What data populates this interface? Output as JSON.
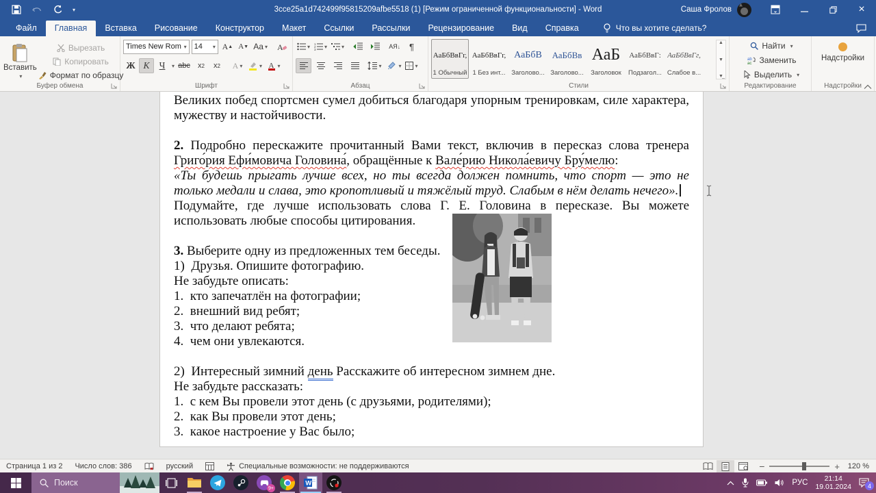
{
  "titlebar": {
    "title": "3cce25a1d742499f95815209afbe5518 (1) [Режим ограниченной функциональности]  -  Word",
    "user_name": "Саша Фролов"
  },
  "tabs": {
    "file": "Файл",
    "items": [
      "Главная",
      "Вставка",
      "Рисование",
      "Конструктор",
      "Макет",
      "Ссылки",
      "Рассылки",
      "Рецензирование",
      "Вид",
      "Справка"
    ],
    "active": "Главная",
    "tell_me": "Что вы хотите сделать?"
  },
  "ribbon": {
    "clipboard": {
      "label": "Буфер обмена",
      "paste": "Вставить",
      "cut": "Вырезать",
      "copy": "Копировать",
      "format_painter": "Формат по образцу"
    },
    "font": {
      "label": "Шрифт",
      "family": "Times New Rom",
      "size": "14",
      "bold": "Ж",
      "italic": "К",
      "underline": "Ч",
      "strike": "abc",
      "case_btn": "Aa",
      "effects": "А",
      "font_color": "А"
    },
    "paragraph": {
      "label": "Абзац",
      "sort": "АЯ",
      "pilcrow": "¶"
    },
    "styles": {
      "label": "Стили",
      "items": [
        {
          "preview": "АаБбВвГг,",
          "name": "1 Обычный"
        },
        {
          "preview": "АаБбВвГг,",
          "name": "1 Без инт..."
        },
        {
          "preview": "АаБбВ",
          "name": "Заголово..."
        },
        {
          "preview": "АаБбВв",
          "name": "Заголово..."
        },
        {
          "preview": "АаБ",
          "name": "Заголовок"
        },
        {
          "preview": "АаБбВвГ:",
          "name": "Подзагол..."
        },
        {
          "preview": "АаБбВвГг,",
          "name": "Слабое в..."
        }
      ]
    },
    "editing": {
      "label": "Редактирование",
      "find": "Найти",
      "replace": "Заменить",
      "select": "Выделить"
    },
    "addins": {
      "label": "Надстройки",
      "button": "Надстройки"
    }
  },
  "document": {
    "top": [
      {
        "cls": "just",
        "runs": [
          {
            "t": "Великих побед спортсмен сумел добиться благодаря упорным тренировкам, силе характера, мужеству и настойчивости."
          }
        ]
      },
      {
        "runs": []
      },
      {
        "cls": "just",
        "runs": [
          {
            "t": "2.",
            "b": true
          },
          {
            "t": " Подробно перескажите прочитанный Вами текст, включив в пересказ слова тренера "
          },
          {
            "t": "Григо́рия Ефи́мовича Головина́",
            "sq": true
          },
          {
            "t": ", обращённые к "
          },
          {
            "t": "Вале́рию Никола́евичу Бру́мелю",
            "sq": true
          },
          {
            "t": ":"
          }
        ]
      },
      {
        "cls": "just",
        "runs": [
          {
            "t": "«Ты будешь прыгать лучше всех, но ты всегда должен помнить, что спорт — это не только медали и слава, это кропотливый и тяжёлый труд. Слабым в нём делать нечего».",
            "i": true
          },
          {
            "caret": true
          }
        ]
      },
      {
        "cls": "just",
        "runs": [
          {
            "t": "Подумайте, где лучше использовать слова Г. Е. Головина в пересказе. Вы можете использовать любые способы цитирования."
          }
        ]
      },
      {
        "runs": []
      }
    ],
    "bottom": [
      {
        "runs": [
          {
            "t": "3.",
            "b": true
          },
          {
            "t": " Выберите одну из предложенных тем беседы."
          }
        ]
      },
      {
        "runs": [
          {
            "t": "1) Друзья. Опишите фотографию."
          }
        ]
      },
      {
        "runs": [
          {
            "t": "Не забудьте описать:"
          }
        ]
      },
      {
        "runs": [
          {
            "t": "1. кто запечатлён на фотографии;"
          }
        ]
      },
      {
        "runs": [
          {
            "t": "2. внешний вид ребят;"
          }
        ]
      },
      {
        "runs": [
          {
            "t": "3. что делают ребята;"
          }
        ]
      },
      {
        "runs": [
          {
            "t": "4. чем они увлекаются."
          }
        ]
      },
      {
        "runs": []
      },
      {
        "runs": [
          {
            "t": "2) Интересный зимний "
          },
          {
            "t": "день",
            "du": true
          },
          {
            "t": " Расскажите об интересном зимнем дне."
          }
        ]
      },
      {
        "runs": [
          {
            "t": "Не забудьте рассказать:"
          }
        ]
      },
      {
        "runs": [
          {
            "t": "1. с кем Вы провели этот день (с друзьями, родителями);"
          }
        ]
      },
      {
        "runs": [
          {
            "t": "2. как Вы провели этот день;"
          }
        ]
      },
      {
        "runs": [
          {
            "t": "3. какое настроение у Вас было;"
          }
        ]
      }
    ]
  },
  "statusbar": {
    "page": "Страница 1 из 2",
    "words": "Число слов: 386",
    "language": "русский",
    "accessibility": "Специальные возможности: не поддерживаются",
    "zoom_level": "120 %"
  },
  "taskbar": {
    "search_placeholder": "Поиск",
    "apps": [
      "file-explorer",
      "telegram",
      "steam",
      "game-center",
      "chrome",
      "word",
      "obs"
    ],
    "game_badge": "9+",
    "tray": {
      "language": "РУС",
      "time": "21:14",
      "date": "19.01.2024",
      "notification_count": "4"
    }
  },
  "colors": {
    "accent_blue": "#2b579a",
    "taskbar_purple": "#543055",
    "squiggle_red": "#e03c31",
    "grammar_blue": "#3d6fd0"
  }
}
